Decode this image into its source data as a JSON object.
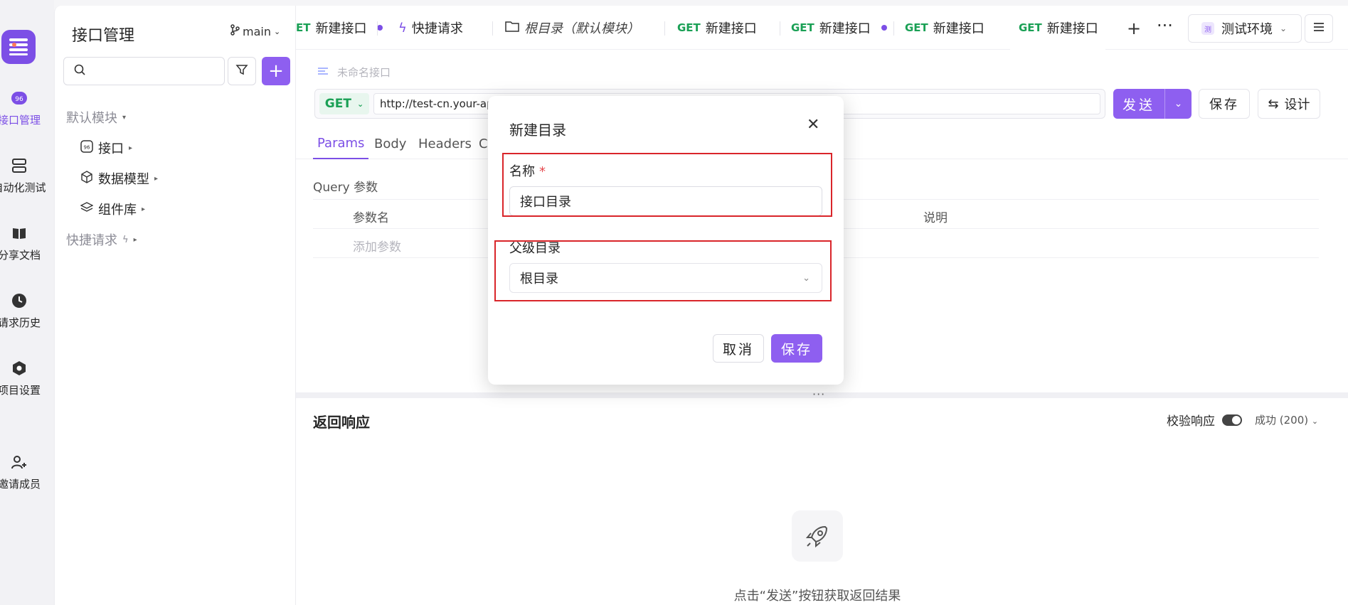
{
  "rail": {
    "items": [
      {
        "label": "接口管理",
        "active": true
      },
      {
        "label": "自动化测试"
      },
      {
        "label": "分享文档"
      },
      {
        "label": "请求历史"
      },
      {
        "label": "项目设置"
      },
      {
        "label": "邀请成员"
      }
    ]
  },
  "sidebar": {
    "title": "接口管理",
    "branch": "main",
    "search_placeholder": "",
    "tree": [
      {
        "label": "默认模块"
      },
      {
        "label": "接口"
      },
      {
        "label": "数据模型"
      },
      {
        "label": "组件库"
      },
      {
        "label": "快捷请求"
      }
    ]
  },
  "tabs": [
    {
      "label": "新建接口",
      "method": "ET",
      "dot": true
    },
    {
      "label": "快捷请求"
    },
    {
      "label": "根目录（默认模块）"
    },
    {
      "label": "新建接口",
      "method": "GET"
    },
    {
      "label": "新建接口",
      "method": "GET",
      "dot": true
    },
    {
      "label": "新建接口",
      "method": "GET"
    },
    {
      "label": "新建接口",
      "method": "GET",
      "active": true
    }
  ],
  "env": {
    "badge": "测",
    "label": "测试环境"
  },
  "request": {
    "name": "未命名接口",
    "method": "GET",
    "url": "http://test-cn.your-api-server.com"
  },
  "actions": {
    "send": "发送",
    "save": "保存",
    "design": "设计"
  },
  "subtabs": [
    "Params",
    "Body",
    "Headers",
    "C"
  ],
  "params": {
    "title": "Query 参数",
    "col_name": "参数名",
    "col_desc": "说明",
    "add_placeholder": "添加参数"
  },
  "response": {
    "title": "返回响应",
    "validate_label": "校验响应",
    "status": "成功 (200)",
    "empty_hint": "点击“发送”按钮获取返回结果"
  },
  "modal": {
    "title": "新建目录",
    "name_label": "名称",
    "required_mark": "*",
    "name_value": "接口目录",
    "parent_label": "父级目录",
    "parent_value": "根目录",
    "cancel": "取消",
    "save": "保存"
  },
  "colors": {
    "accent": "#8e5ff0",
    "get": "#1aa055",
    "highlight": "#d9252a"
  }
}
